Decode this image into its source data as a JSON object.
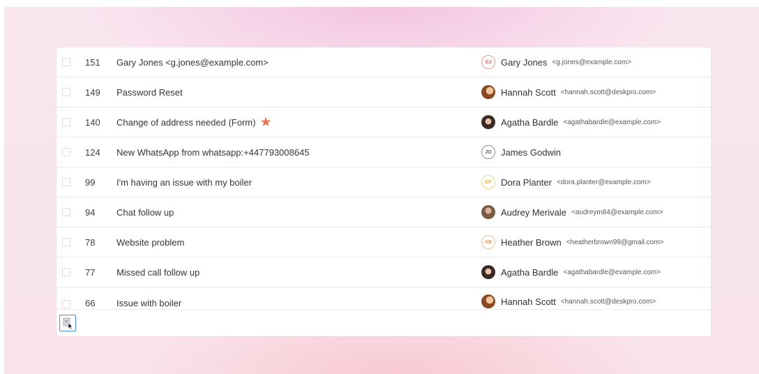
{
  "tickets": [
    {
      "id": "151",
      "subject": "Gary Jones <g.jones@example.com>",
      "starred": false,
      "person": {
        "name": "Gary Jones",
        "email": "<g.jones@example.com>",
        "initials": "GJ",
        "avatar": "initials-red"
      }
    },
    {
      "id": "149",
      "subject": "Password Reset",
      "starred": false,
      "person": {
        "name": "Hannah Scott",
        "email": "<hannah.scott@deskpro.com>",
        "initials": "",
        "avatar": "photo-1"
      }
    },
    {
      "id": "140",
      "subject": "Change of address needed (Form)",
      "starred": true,
      "person": {
        "name": "Agatha Bardle",
        "email": "<agathabardle@example.com>",
        "initials": "",
        "avatar": "photo-2"
      }
    },
    {
      "id": "124",
      "subject": "New WhatsApp from whatsapp:+447793008645",
      "starred": false,
      "person": {
        "name": "James Godwin",
        "email": "",
        "initials": "JG",
        "avatar": "initials-grey"
      }
    },
    {
      "id": "99",
      "subject": "I'm having an issue with my boiler",
      "starred": false,
      "person": {
        "name": "Dora Planter",
        "email": "<dora.planter@example.com>",
        "initials": "DP",
        "avatar": "initials-yellow"
      }
    },
    {
      "id": "94",
      "subject": "Chat follow up",
      "starred": false,
      "person": {
        "name": "Audrey Merivale",
        "email": "<audreym84@example.com>",
        "initials": "",
        "avatar": "photo-3"
      }
    },
    {
      "id": "78",
      "subject": "Website problem",
      "starred": false,
      "person": {
        "name": "Heather Brown",
        "email": "<heatherbrown99@gmail.com>",
        "initials": "HB",
        "avatar": "initials-orange"
      }
    },
    {
      "id": "77",
      "subject": "Missed call follow up",
      "starred": false,
      "person": {
        "name": "Agatha Bardle",
        "email": "<agathabardle@example.com>",
        "initials": "",
        "avatar": "photo-2"
      }
    },
    {
      "id": "66",
      "subject": "Issue with boiler",
      "starred": false,
      "person": {
        "name": "Hannah Scott",
        "email": "<hannah.scott@deskpro.com>",
        "initials": "",
        "avatar": "photo-1"
      }
    }
  ],
  "toolbar": {
    "icon": "document-cursor-icon"
  },
  "colors": {
    "star": "#f07152",
    "accent": "#4a90d9"
  }
}
